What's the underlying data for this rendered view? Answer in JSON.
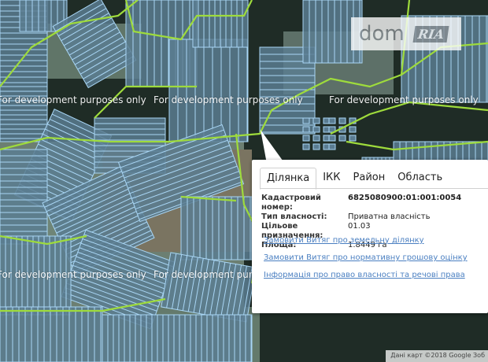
{
  "watermark": "For development purposes only",
  "logo": {
    "text": "dom",
    "badge": "RIA"
  },
  "popup": {
    "tabs": [
      "Ділянка",
      "ІКК",
      "Район",
      "Область"
    ],
    "active_tab": 0,
    "fields": [
      {
        "label": "Кадастровий номер:",
        "value": "6825080900:01:001:0054"
      },
      {
        "label": "Тип власності:",
        "value": "Приватна власність"
      },
      {
        "label": "Цільове призначення:",
        "value": "01.03"
      },
      {
        "label": "Площа:",
        "value": "1.8449 га"
      }
    ],
    "links": [
      "Замовити Витяг про земельну ділянку",
      "Замовити Витяг про нормативну грошову оцінку",
      "Інформація про право власності та речові права"
    ]
  },
  "attribution": "Дані карт ©2018 Google Зоб",
  "colors": {
    "parcel_fill": "#5a7c91",
    "parcel_line": "#a9d6f5",
    "border_green": "#9edb3c",
    "forest": "#1c2a22",
    "field": "#647a6c"
  }
}
